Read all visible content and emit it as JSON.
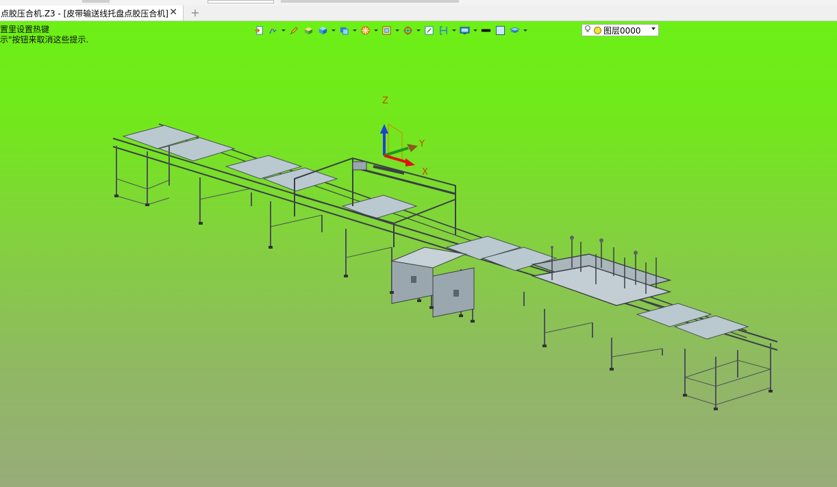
{
  "window": {
    "tab_title": "点胶压合机.Z3 - [皮带输送线托盘点胶压合机]",
    "close_glyph": "✕",
    "new_tab_glyph": "+"
  },
  "hints": [
    "置里设置热键",
    "示\"按钮来取消这些提示."
  ],
  "toolbar": {
    "icons": [
      "exit-icon",
      "sketch-icon",
      "edit-icon",
      "box-icon",
      "solid-view-icon",
      "shaded-view-icon",
      "render-icon",
      "view-frame-icon",
      "rotate-view-icon",
      "fit-view-icon",
      "section-icon",
      "display-icon",
      "black-color-icon",
      "face-color-icon",
      "layer-stack-icon"
    ],
    "layer": {
      "name": "图层0000"
    }
  },
  "axes": {
    "x": "X",
    "y": "Y",
    "z": "Z"
  },
  "colors": {
    "viewport_top": "#6cf016",
    "viewport_bottom": "#98ac7a",
    "axis_x": "#e01010",
    "axis_y": "#1a9a1a",
    "axis_z": "#1f3fd8",
    "axis_label": "#c04a00"
  }
}
